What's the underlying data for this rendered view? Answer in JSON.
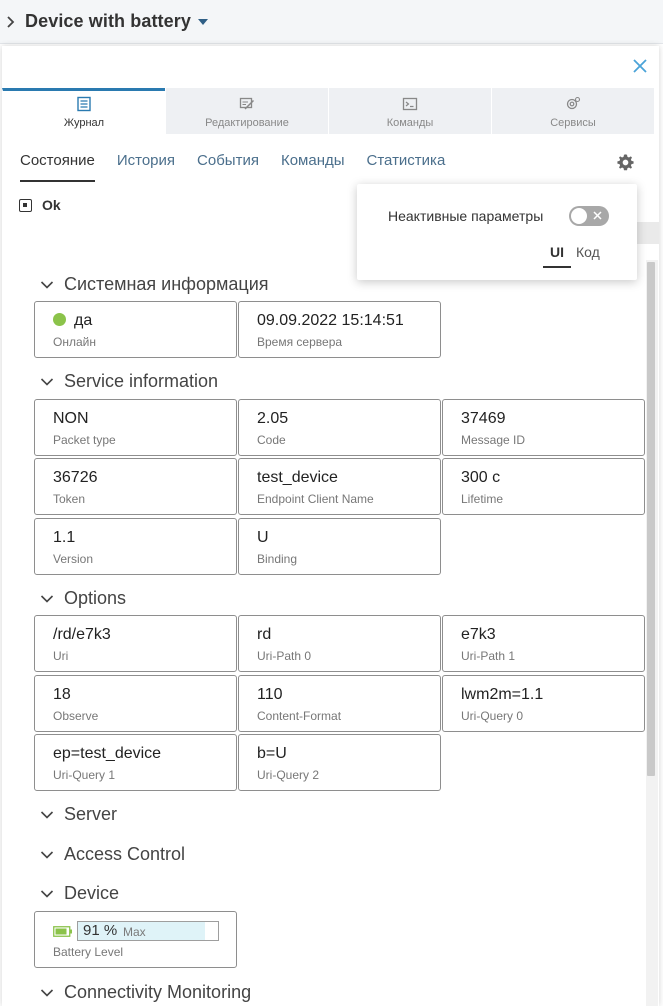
{
  "header": {
    "title": "Device with battery"
  },
  "mode_tabs": [
    {
      "label": "Журнал",
      "icon": "log-icon",
      "active": true
    },
    {
      "label": "Редактирование",
      "icon": "edit-icon",
      "active": false
    },
    {
      "label": "Команды",
      "icon": "terminal-icon",
      "active": false
    },
    {
      "label": "Сервисы",
      "icon": "services-gear-icon",
      "active": false
    }
  ],
  "sub_tabs": [
    {
      "label": "Состояние",
      "active": true
    },
    {
      "label": "История",
      "active": false
    },
    {
      "label": "События",
      "active": false
    },
    {
      "label": "Команды",
      "active": false
    },
    {
      "label": "Статистика",
      "active": false
    }
  ],
  "status": {
    "label": "Ok"
  },
  "popup": {
    "inactive_label": "Неактивные параметры",
    "inactive_enabled": false,
    "view_ui": "UI",
    "view_code": "Код",
    "view_selected": "UI"
  },
  "sections": {
    "system": {
      "title": "Системная информация",
      "cards": [
        {
          "value": "да",
          "key": "Онлайн"
        },
        {
          "value": "09.09.2022 15:14:51",
          "key": "Время сервера"
        }
      ]
    },
    "service": {
      "title": "Service information",
      "cards": [
        {
          "value": "NON",
          "key": "Packet type"
        },
        {
          "value": "2.05",
          "key": "Code"
        },
        {
          "value": "37469",
          "key": "Message ID"
        },
        {
          "value": "36726",
          "key": "Token"
        },
        {
          "value": "test_device",
          "key": "Endpoint Client Name"
        },
        {
          "value": "300 с",
          "key": "Lifetime"
        },
        {
          "value": "1.1",
          "key": "Version"
        },
        {
          "value": "U",
          "key": "Binding"
        }
      ]
    },
    "options": {
      "title": "Options",
      "cards": [
        {
          "value": "/rd/e7k3",
          "key": "Uri"
        },
        {
          "value": "rd",
          "key": "Uri-Path 0"
        },
        {
          "value": "e7k3",
          "key": "Uri-Path 1"
        },
        {
          "value": "18",
          "key": "Observe"
        },
        {
          "value": "110",
          "key": "Content-Format"
        },
        {
          "value": "lwm2m=1.1",
          "key": "Uri-Query 0"
        },
        {
          "value": "ep=test_device",
          "key": "Uri-Query 1"
        },
        {
          "value": "b=U",
          "key": "Uri-Query 2"
        }
      ]
    },
    "server": {
      "title": "Server"
    },
    "access": {
      "title": "Access Control"
    },
    "device": {
      "title": "Device",
      "battery": {
        "value": "91 %",
        "max": "Max",
        "key": "Battery Level",
        "level_percent": 91
      }
    },
    "connectivity": {
      "title": "Connectivity Monitoring"
    }
  },
  "colors": {
    "accent": "#2a7ab0",
    "online": "#8bc34a",
    "close": "#4aa3d8"
  }
}
